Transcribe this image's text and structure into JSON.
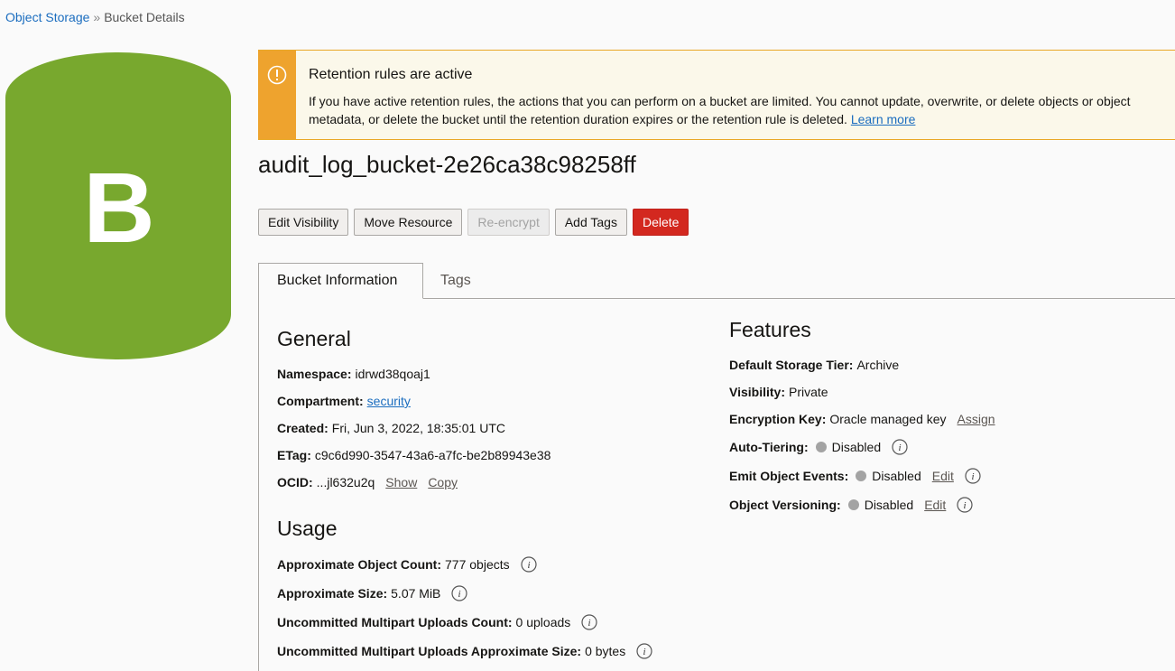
{
  "breadcrumb": {
    "root": "Object Storage",
    "separator": "»",
    "current": "Bucket Details"
  },
  "bucket_icon": {
    "letter": "B",
    "color": "#78a82e"
  },
  "alert": {
    "title": "Retention rules are active",
    "body": "If you have active retention rules, the actions that you can perform on a bucket are limited. You cannot update, overwrite, or delete objects or object metadata, or delete the bucket until the retention duration expires or the retention rule is deleted.",
    "link": "Learn more",
    "icon": "warning-icon",
    "color": "#eea32e"
  },
  "title": "audit_log_bucket-2e26ca38c98258ff",
  "actions": {
    "edit_visibility": "Edit Visibility",
    "move_resource": "Move Resource",
    "re_encrypt": "Re-encrypt",
    "add_tags": "Add Tags",
    "delete": "Delete"
  },
  "tabs": [
    {
      "label": "Bucket Information",
      "active": true
    },
    {
      "label": "Tags",
      "active": false
    }
  ],
  "general": {
    "title": "General",
    "namespace_label": "Namespace:",
    "namespace": "idrwd38qoaj1",
    "compartment_label": "Compartment:",
    "compartment": "security",
    "created_label": "Created:",
    "created": "Fri, Jun 3, 2022, 18:35:01 UTC",
    "etag_label": "ETag:",
    "etag": "c9c6d990-3547-43a6-a7fc-be2b89943e38",
    "ocid_label": "OCID:",
    "ocid": "...jl632u2q",
    "show": "Show",
    "copy": "Copy"
  },
  "usage": {
    "title": "Usage",
    "object_count_label": "Approximate Object Count:",
    "object_count": "777 objects",
    "size_label": "Approximate Size:",
    "size": "5.07 MiB",
    "multipart_count_label": "Uncommitted Multipart Uploads Count:",
    "multipart_count": "0 uploads",
    "multipart_size_label": "Uncommitted Multipart Uploads Approximate Size:",
    "multipart_size": "0 bytes"
  },
  "features": {
    "title": "Features",
    "storage_tier_label": "Default Storage Tier:",
    "storage_tier": "Archive",
    "visibility_label": "Visibility:",
    "visibility": "Private",
    "encryption_label": "Encryption Key:",
    "encryption": "Oracle managed key",
    "assign": "Assign",
    "auto_tiering_label": "Auto-Tiering:",
    "auto_tiering": "Disabled",
    "emit_events_label": "Emit Object Events:",
    "emit_events": "Disabled",
    "versioning_label": "Object Versioning:",
    "versioning": "Disabled",
    "edit": "Edit"
  }
}
